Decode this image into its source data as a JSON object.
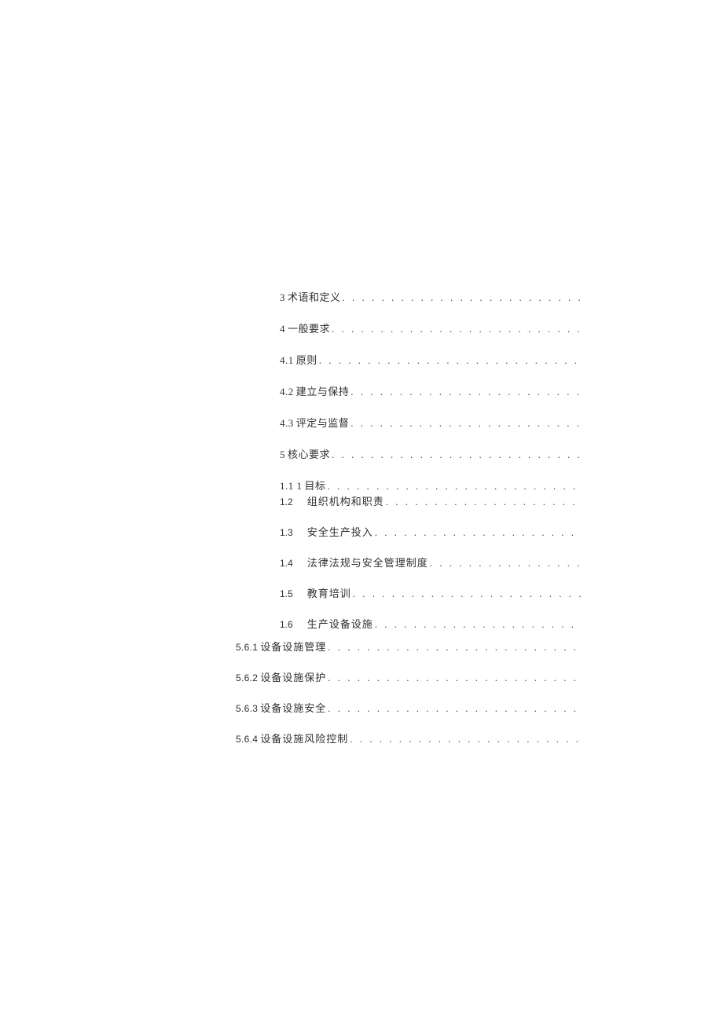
{
  "toc": {
    "block1": [
      {
        "num": "3",
        "title": "术语和定义"
      },
      {
        "num": "4",
        "title": "一般要求"
      },
      {
        "num": "4.1",
        "title": "原则"
      },
      {
        "num": "4.2",
        "title": "建立与保持"
      },
      {
        "num": "4.3",
        "title": "评定与监督"
      },
      {
        "num": "5",
        "title": "核心要求"
      },
      {
        "num": "1.1 1",
        "title": "目标"
      }
    ],
    "block2": [
      {
        "num": "1.2",
        "title": "组织机构和职责"
      },
      {
        "num": "1.3",
        "title": "安全生产投入"
      },
      {
        "num": "1.4",
        "title": "法律法规与安全管理制度"
      },
      {
        "num": "1.5",
        "title": "教育培训"
      },
      {
        "num": "1.6",
        "title": "生产设备设施"
      }
    ],
    "block3": [
      {
        "num": "5.6.1",
        "title": "设备设施管理"
      },
      {
        "num": "5.6.2",
        "title": "设备设施保护"
      },
      {
        "num": "5.6.3",
        "title": "设备设施安全"
      },
      {
        "num": "5.6.4",
        "title": "设备设施风险控制"
      }
    ]
  },
  "dots": ". . . . . . . . . . . . . . . . . . . . . . . . . . . . . . . . . . . . . . . . . . . . . . . . . . . . . . . . . . . . . . . . . . . . . . . . . . . . . . . ."
}
